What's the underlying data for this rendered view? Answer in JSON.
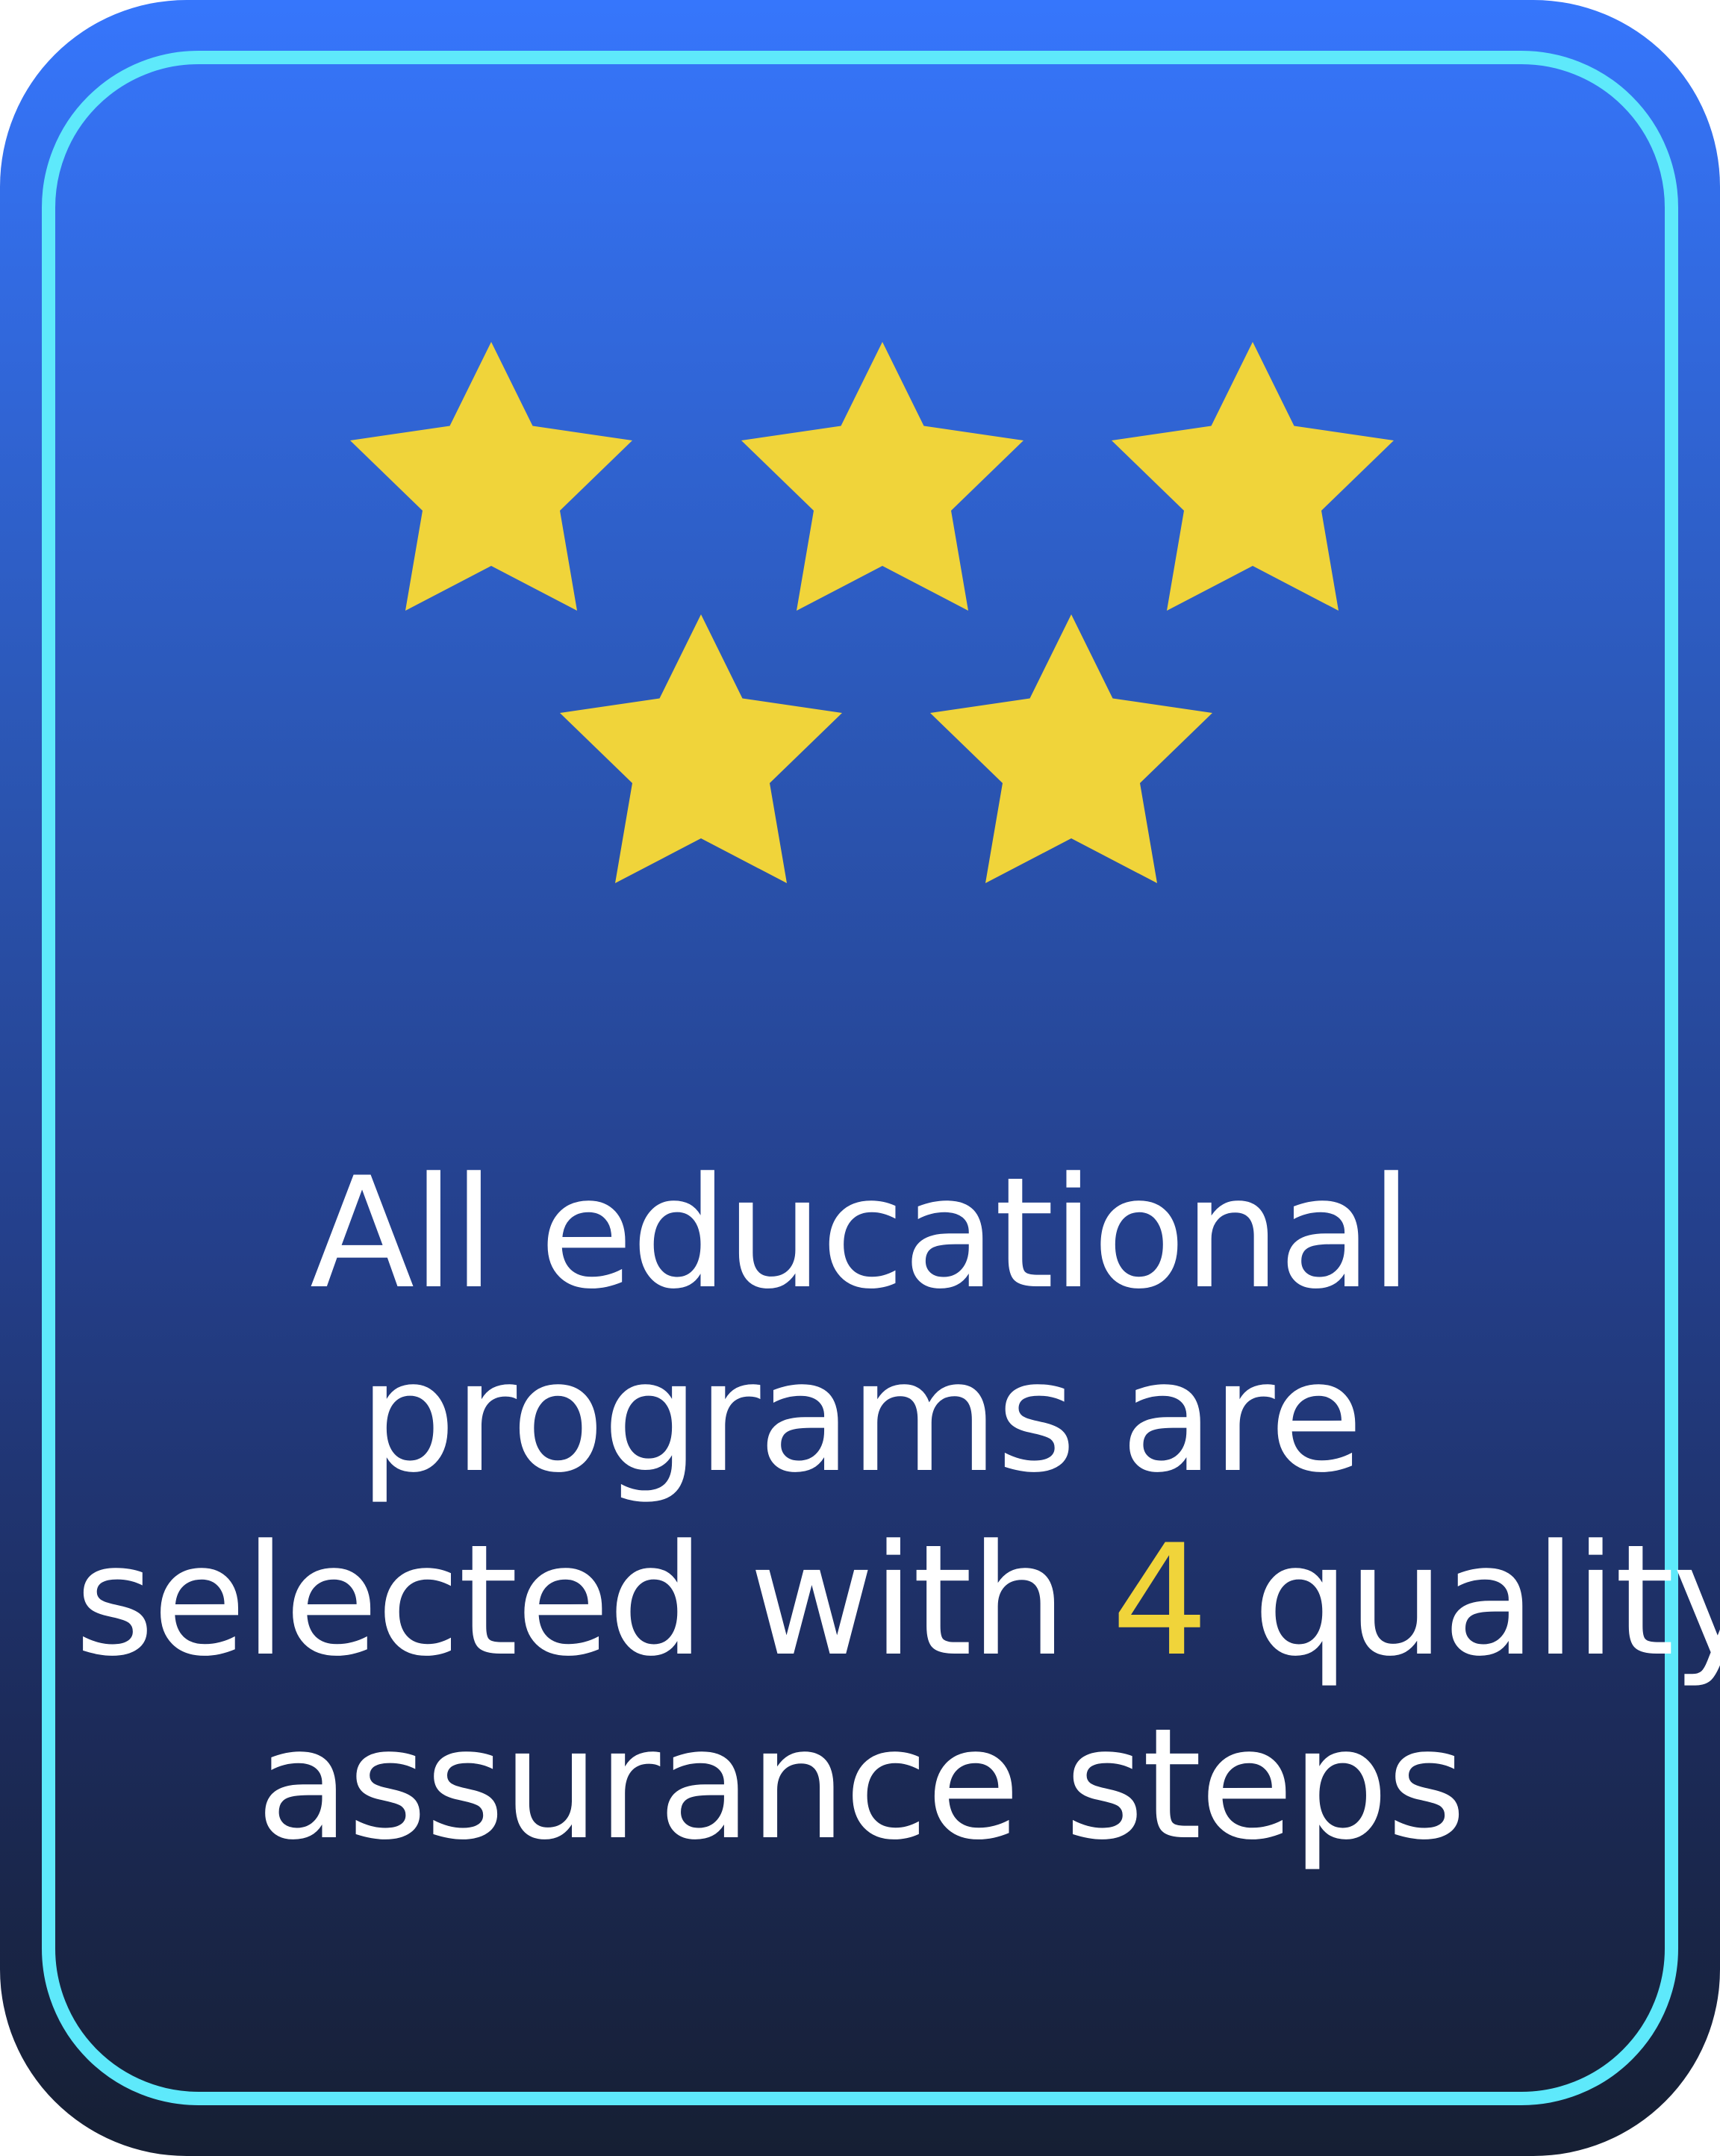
{
  "rating": {
    "stars": 5
  },
  "message": {
    "line1": "All educational",
    "line2": "programs are",
    "line3_before": "selected with ",
    "line3_highlight": "4",
    "line3_after": " quality",
    "line4": "assurance steps"
  },
  "colors": {
    "card_top": "#3676fc",
    "card_bottom": "#161f33",
    "frame": "#5ee9fb",
    "star": "#f0d43a",
    "text": "#ffffff",
    "highlight": "#f0d43a"
  }
}
